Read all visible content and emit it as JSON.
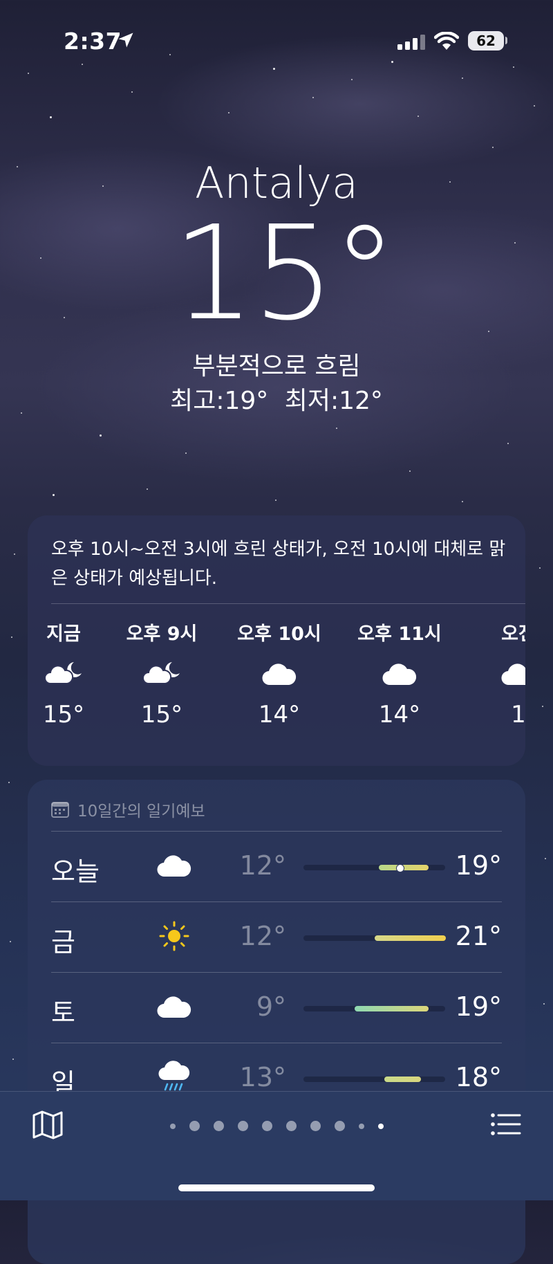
{
  "status_bar": {
    "time": "2:37",
    "battery": "62"
  },
  "header": {
    "city": "Antalya",
    "temperature": "15°",
    "condition": "부분적으로 흐림",
    "high": "최고:19°",
    "low": "최저:12°"
  },
  "hourly": {
    "summary": "오후 10시~오전 3시에 흐린 상태가, 오전 10시에 대체로 맑은 상태가 예상됩니다.",
    "items": [
      {
        "label": "지금",
        "icon": "partly-cloudy-night-icon",
        "temp": "15°"
      },
      {
        "label": "오후 9시",
        "icon": "partly-cloudy-night-icon",
        "temp": "15°"
      },
      {
        "label": "오후 10시",
        "icon": "cloud-icon",
        "temp": "14°"
      },
      {
        "label": "오후 11시",
        "icon": "cloud-icon",
        "temp": "14°"
      },
      {
        "label": "오전",
        "icon": "cloud-icon",
        "temp": "1"
      }
    ]
  },
  "daily": {
    "title": "10일간의 일기예보",
    "days": [
      {
        "day": "오늘",
        "icon": "cloud-icon",
        "low": "12°",
        "high": "19°",
        "range_start": 0.53,
        "range_end": 0.88,
        "current_marker": 0.68,
        "color_from": "#b8d88a",
        "color_to": "#e5d36a"
      },
      {
        "day": "금",
        "icon": "sun-icon",
        "low": "12°",
        "high": "21°",
        "range_start": 0.5,
        "range_end": 1.0,
        "color_from": "#d6d88a",
        "color_to": "#f0cf4e"
      },
      {
        "day": "토",
        "icon": "cloud-icon",
        "low": "9°",
        "high": "19°",
        "range_start": 0.36,
        "range_end": 0.88,
        "color_from": "#8fd8b2",
        "color_to": "#dcd67a"
      },
      {
        "day": "일",
        "icon": "cloud-rain-icon",
        "low": "13°",
        "high": "18°",
        "range_start": 0.57,
        "range_end": 0.83,
        "color_from": "#c9da8a",
        "color_to": "#d9d67e"
      }
    ]
  },
  "pager": {
    "count": 10,
    "active_index": 9
  },
  "colors": {
    "accent_sun": "#f7c81b",
    "rain": "#4fb7f2"
  }
}
